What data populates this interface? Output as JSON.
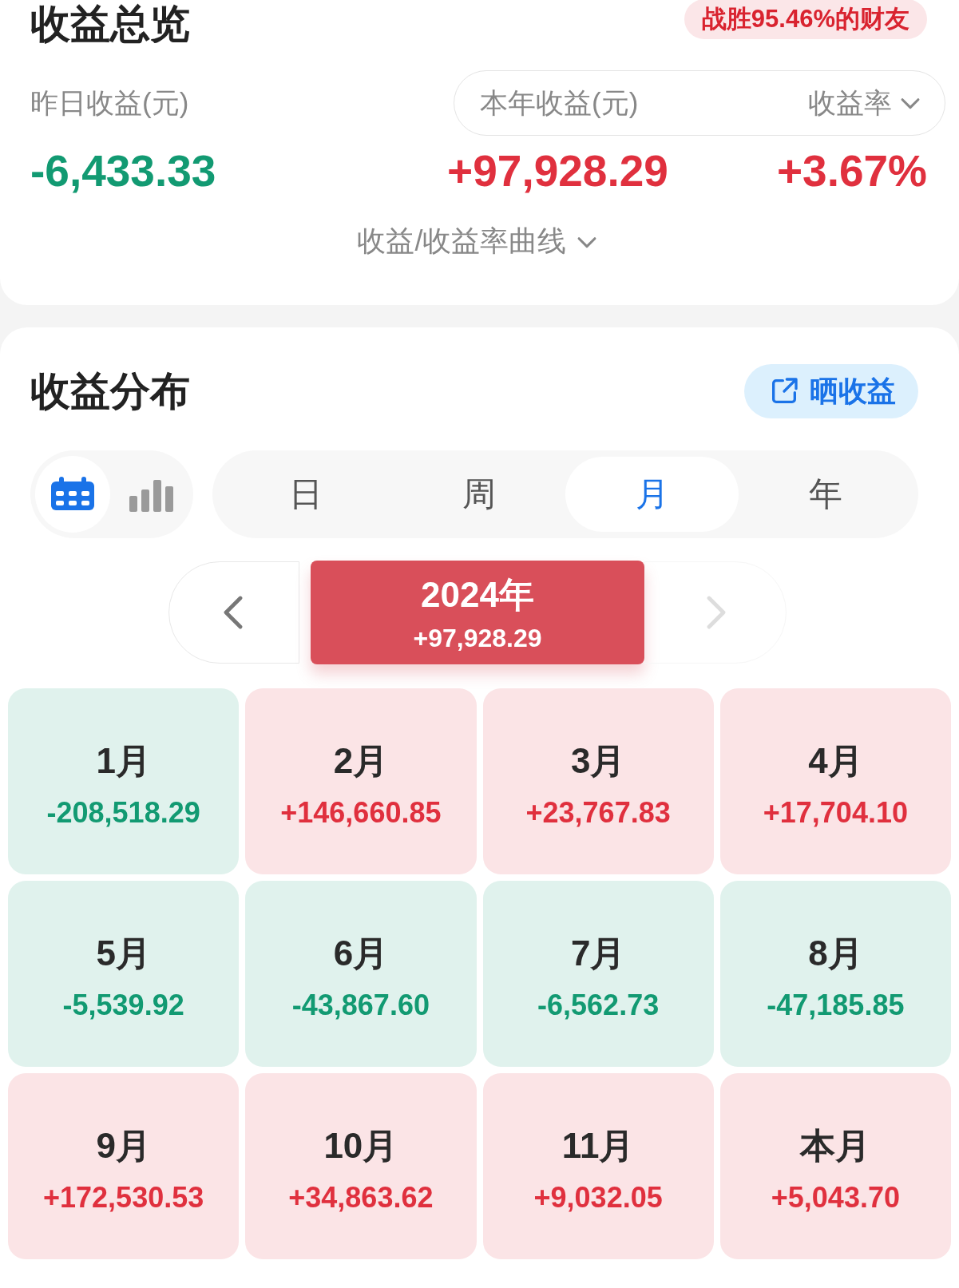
{
  "overview": {
    "title": "收益总览",
    "badge": "战胜95.46%的财友",
    "yesterday": {
      "label": "昨日收益(元)",
      "value": "-6,433.33",
      "color": "#129a72"
    },
    "year": {
      "label": "本年收益(元)",
      "value": "+97,928.29",
      "color": "#e0303e"
    },
    "rate": {
      "label": "收益率",
      "value": "+3.67%",
      "color": "#e0303e"
    },
    "curve_link": "收益/收益率曲线"
  },
  "distribution": {
    "title": "收益分布",
    "share_button": "晒收益",
    "view_toggle": [
      {
        "kind": "calendar",
        "selected": true
      },
      {
        "kind": "bars",
        "selected": false
      }
    ],
    "periods": [
      {
        "label": "日",
        "selected": false
      },
      {
        "label": "周",
        "selected": false
      },
      {
        "label": "月",
        "selected": true
      },
      {
        "label": "年",
        "selected": false
      }
    ],
    "year_nav": {
      "label": "2024年",
      "value": "+97,928.29"
    },
    "months": [
      {
        "label": "1月",
        "value": "-208,518.29",
        "color": "#129a72"
      },
      {
        "label": "2月",
        "value": "+146,660.85",
        "color": "#e0303e"
      },
      {
        "label": "3月",
        "value": "+23,767.83",
        "color": "#e0303e"
      },
      {
        "label": "4月",
        "value": "+17,704.10",
        "color": "#e0303e"
      },
      {
        "label": "5月",
        "value": "-5,539.92",
        "color": "#129a72"
      },
      {
        "label": "6月",
        "value": "-43,867.60",
        "color": "#129a72"
      },
      {
        "label": "7月",
        "value": "-6,562.73",
        "color": "#129a72"
      },
      {
        "label": "8月",
        "value": "-47,185.85",
        "color": "#129a72"
      },
      {
        "label": "9月",
        "value": "+172,530.53",
        "color": "#e0303e"
      },
      {
        "label": "10月",
        "value": "+34,863.62",
        "color": "#e0303e"
      },
      {
        "label": "11月",
        "value": "+9,032.05",
        "color": "#e0303e"
      },
      {
        "label": "本月",
        "value": "+5,043.70",
        "color": "#e0303e"
      }
    ]
  }
}
